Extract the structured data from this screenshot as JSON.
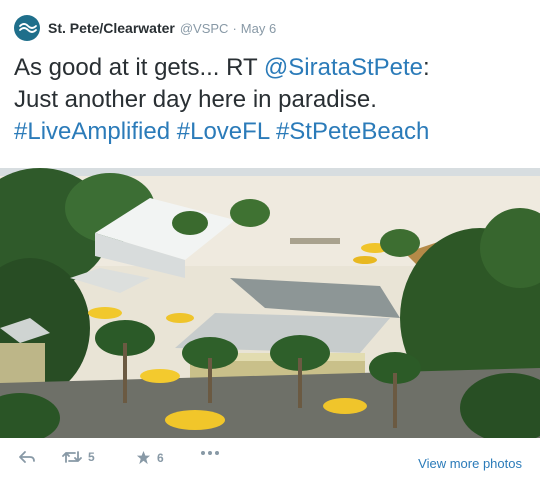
{
  "account": {
    "name": "St. Pete/Clearwater",
    "handle": "@VSPC",
    "separator": "·",
    "time": "May 6"
  },
  "tweet": {
    "line1_prefix": "As good at it gets... RT ",
    "mention": "@SirataStPete",
    "line1_suffix": ":",
    "line2": "Just another day here in paradise.",
    "hashtags": [
      "#LiveAmplified",
      "#LoveFL",
      "#StPeteBeach"
    ]
  },
  "actions": {
    "retweet_count": "5",
    "favorite_count": "6",
    "view_more_label": "View more photos"
  },
  "colors": {
    "link": "#2b7bb9",
    "meta": "#8899a6",
    "text": "#292f33"
  }
}
